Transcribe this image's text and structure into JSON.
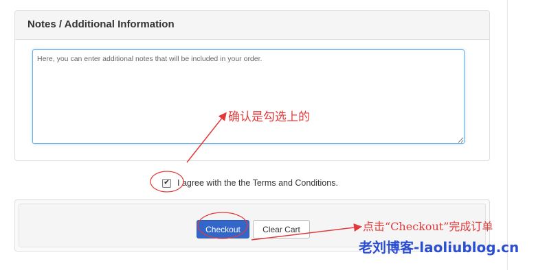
{
  "notes_panel": {
    "heading": "Notes / Additional Information",
    "placeholder": "Here, you can enter additional notes that will be included in your order."
  },
  "terms": {
    "checked": true,
    "check_glyph": "✔",
    "label": "I agree with the the Terms and Conditions."
  },
  "actions": {
    "checkout_label": "Checkout",
    "clear_cart_label": "Clear Cart"
  },
  "annotations": {
    "confirm_checked": "确认是勾选上的",
    "click_checkout": "点击“Checkout”完成订单",
    "color": "#e23a3a"
  },
  "watermark": "老刘博客-laoliublog.cn"
}
